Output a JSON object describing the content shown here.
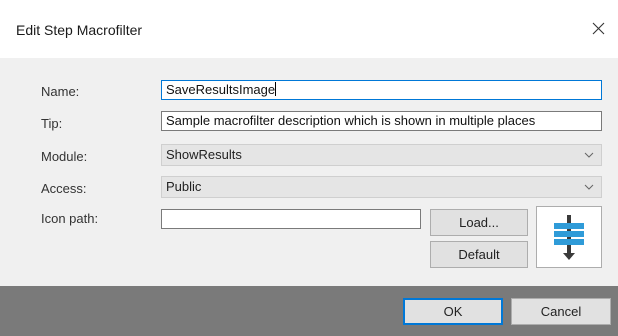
{
  "dialog": {
    "title": "Edit Step Macrofilter"
  },
  "fields": {
    "name_label": "Name:",
    "name_value": "SaveResultsImage",
    "tip_label": "Tip:",
    "tip_value": "Sample macrofilter description which is shown in multiple places",
    "module_label": "Module:",
    "module_value": "ShowResults",
    "access_label": "Access:",
    "access_value": "Public",
    "icon_path_label": "Icon path:",
    "icon_path_value": ""
  },
  "buttons": {
    "load_label": "Load...",
    "default_label": "Default",
    "ok_label": "OK",
    "cancel_label": "Cancel"
  },
  "icons": {
    "close": "close-icon",
    "dropdown": "chevron-down-icon",
    "preview": "macrofilter-step-icon"
  },
  "colors": {
    "focus_accent": "#0078d7",
    "icon_blue": "#2f9bd8",
    "icon_dark": "#3a3a3a"
  }
}
